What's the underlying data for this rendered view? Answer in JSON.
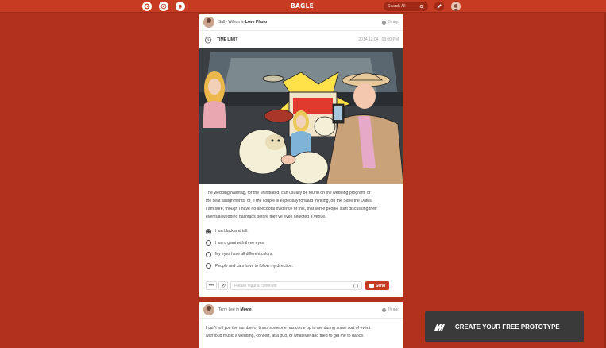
{
  "app": {
    "brand": "BAGLE"
  },
  "nav": {
    "search_placeholder": "Search All",
    "icons": [
      "app-logo-icon",
      "compass-icon",
      "bell-icon",
      "search-icon",
      "pencil-icon",
      "avatar"
    ]
  },
  "colors": {
    "accent": "#c63b22",
    "background": "#b2311c",
    "promo_bg": "#3a3a3a"
  },
  "posts": [
    {
      "author": "Sally Wilson",
      "in_word": "in",
      "group": "Love Photo",
      "time": "2h ago",
      "timelimit_label": "TIME LIMIT",
      "timelimit_date": "2014.12.04 / 03:00 PM",
      "body": [
        "The wedding hashtag, for the uninitiated, can usually be found on the wedding program, or",
        "the seat assignments, or, if the couple is  especially forward thinking, on the Save the Dates.",
        "I am sure, though I have no anecdotal evidence of this, that some people start discussing their",
        "eventual wedding hashtags before they've even selected a venue."
      ],
      "options": [
        {
          "label": "I am black and tall.",
          "checked": true
        },
        {
          "label": "I am a giant with three eyes.",
          "checked": false
        },
        {
          "label": "My eyes have all different colors.",
          "checked": false
        },
        {
          "label": "People and cars have to follow my direction.",
          "checked": false
        }
      ],
      "more_label": "•••",
      "comment_placeholder": "Please input a comment",
      "send_label": "Send"
    },
    {
      "author": "Terry Lee",
      "in_word": "in",
      "group": "Movie",
      "time": "2h ago",
      "body": [
        "I can't tell you the number of times someone has come up to me during some sort of event",
        "with loud music a wedding, concert, at a pub, or whatever and tried to get me to dance."
      ]
    }
  ],
  "promo": {
    "text": "CREATE YOUR FREE PROTOTYPE"
  }
}
